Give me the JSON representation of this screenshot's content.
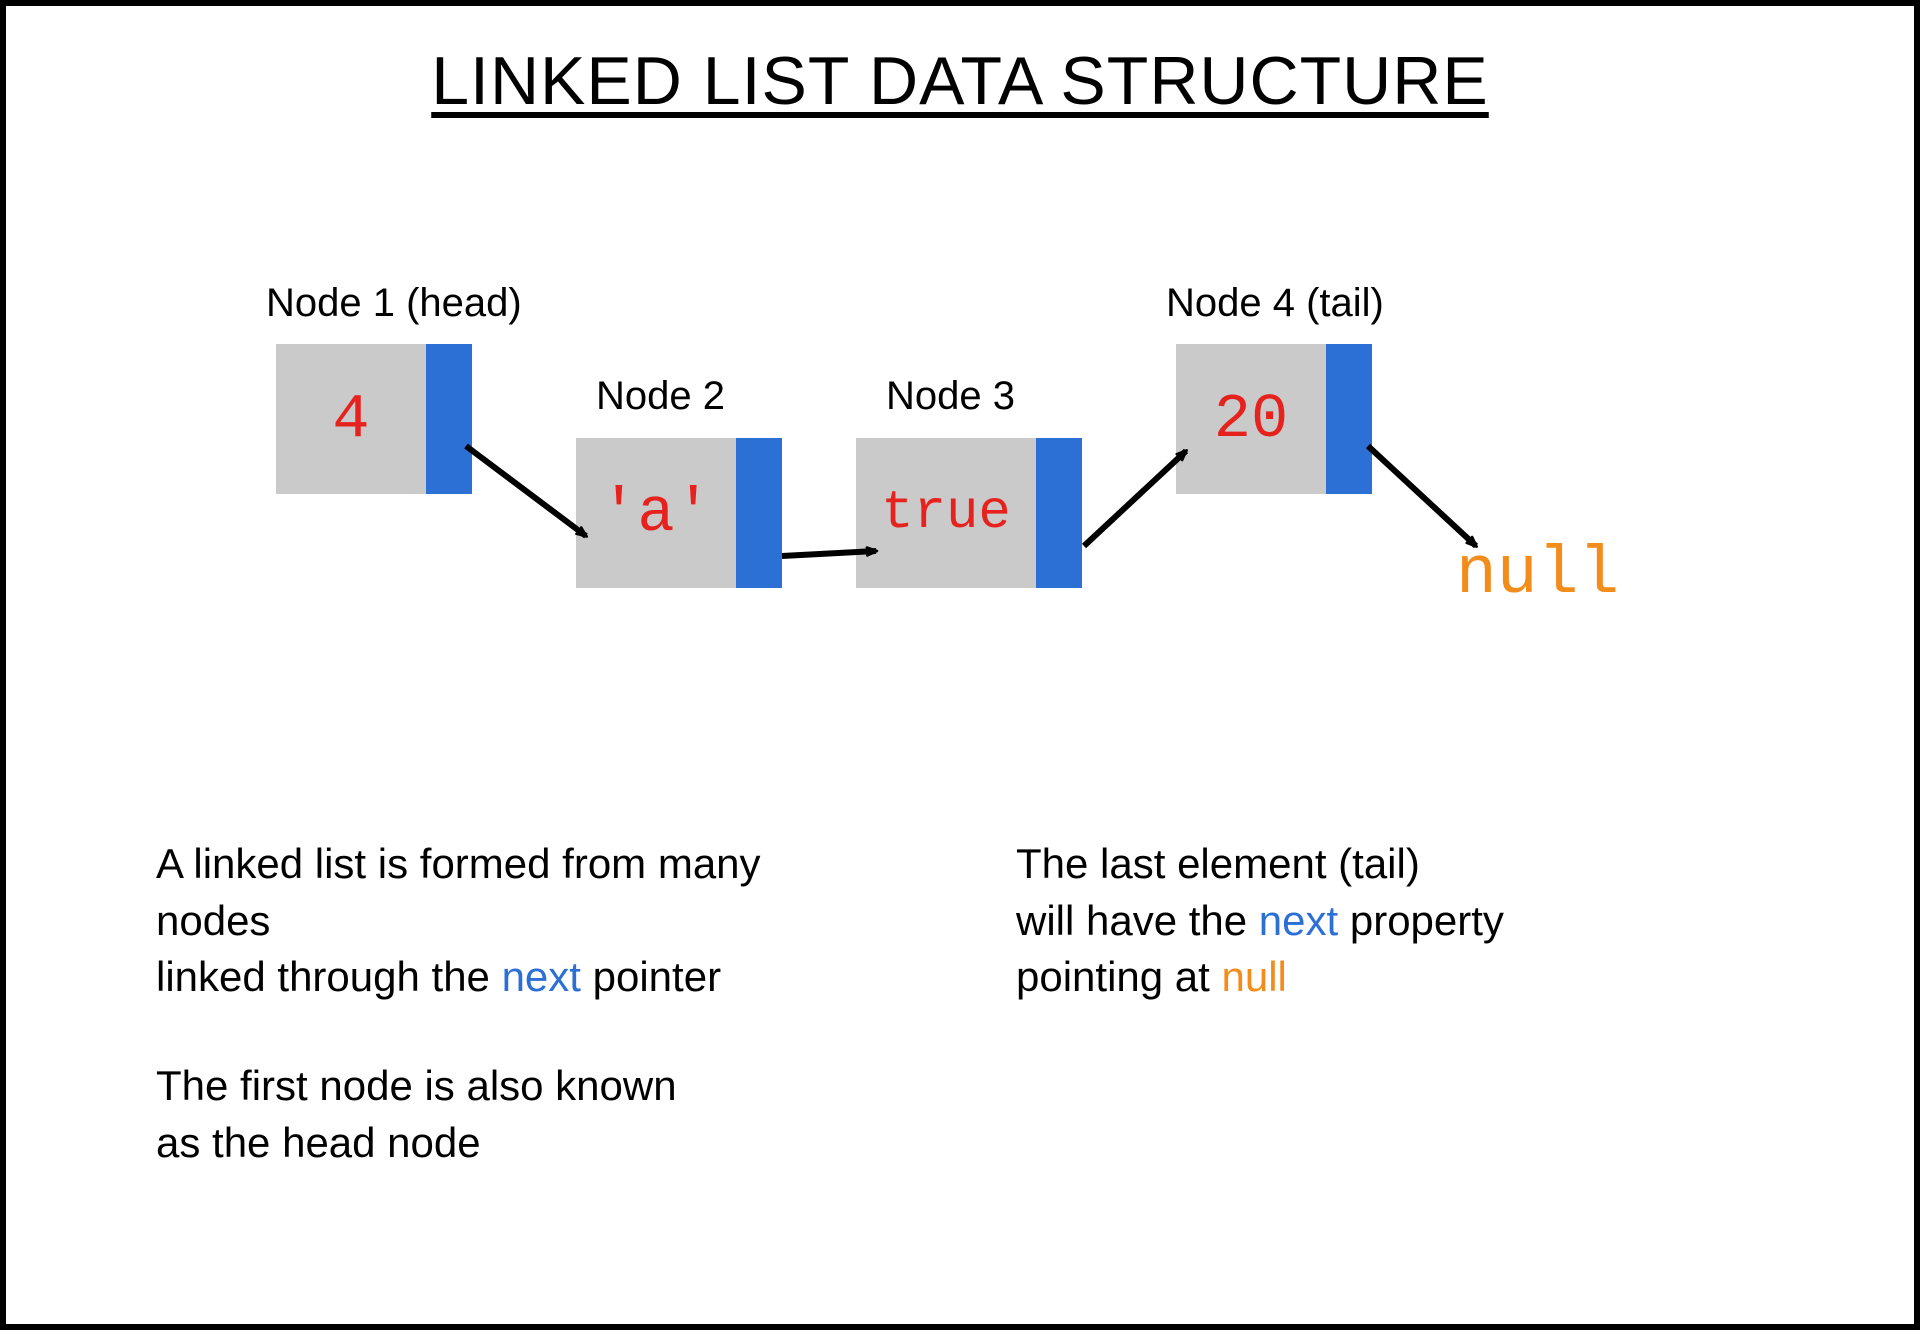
{
  "title": "LINKED LIST DATA STRUCTURE",
  "nodes": [
    {
      "label": "Node 1 (head)",
      "value": "4"
    },
    {
      "label": "Node 2",
      "value": "'a'"
    },
    {
      "label": "Node 3",
      "value": "true"
    },
    {
      "label": "Node 4 (tail)",
      "value": "20"
    }
  ],
  "null_label": "null",
  "desc_left": {
    "p1_a": "A linked list is formed from many nodes",
    "p1_b": "linked through the ",
    "p1_next": "next",
    "p1_c": " pointer",
    "p2_a": "The first node is also known",
    "p2_b": "as the head node"
  },
  "desc_right": {
    "p1_a": "The last element (tail)",
    "p1_b": "will have the ",
    "p1_next": "next",
    "p1_c": " property",
    "p2_a": "pointing at ",
    "p2_null": "null"
  },
  "colors": {
    "node_fill": "#cacaca",
    "pointer_fill": "#2c70d6",
    "value_color": "#e6221f",
    "null_color": "#f28c1a",
    "keyword_next": "#2c70d6"
  }
}
